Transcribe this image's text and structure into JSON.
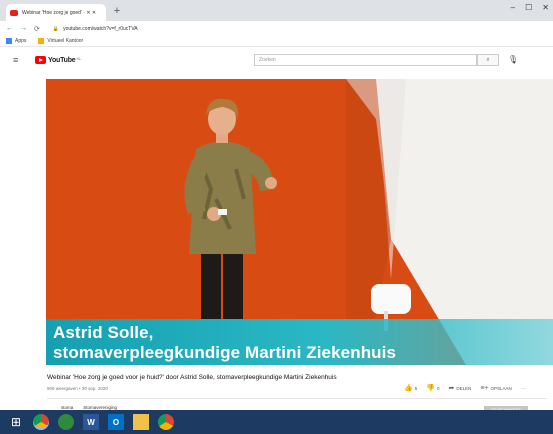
{
  "browser": {
    "tab_title": "Webinar 'Hoe zorg je goed' · ✕ ✕",
    "new_tab_symbol": "+",
    "url": "youtube.com/watch?v=f_r0ucTVA",
    "bookmarks": [
      {
        "label": "Apps",
        "icon": "apps-grid-icon"
      },
      {
        "label": "Virtueel Kantoor",
        "icon": "bookmark-icon"
      }
    ],
    "window_controls": [
      "–",
      "☐",
      "✕"
    ]
  },
  "youtube": {
    "logo_text": "YouTube",
    "logo_region": "NL",
    "search_placeholder": "Zoeken",
    "search_icon": "search-icon",
    "mic_icon": "mic-icon"
  },
  "video": {
    "lower_third_line1": "Astrid Solle,",
    "lower_third_line2": "stomaverpleegkundige Martini Ziekenhuis",
    "colors": {
      "wall_orange": "#d84c14",
      "teal": "#1aa6b6"
    }
  },
  "below_video": {
    "title": "Webinar 'Hoe zorg je goed voor je huid?' door Astrid Solle, stomaverpleegkundige Martini Ziekenhuis",
    "meta": "909 weergaven • 30 sep. 2020",
    "actions": [
      {
        "icon": "thumbs-up-icon",
        "label": "5"
      },
      {
        "icon": "thumbs-down-icon",
        "label": "0"
      },
      {
        "icon": "share-icon",
        "label": "DELEN"
      },
      {
        "icon": "save-icon",
        "label": "OPSLAAN"
      },
      {
        "icon": "more-icon",
        "label": "···"
      }
    ],
    "channel_items": [
      "stoma",
      "Stomavereniging"
    ],
    "subscribe_label": "GEABONNEERD"
  },
  "taskbar": {
    "items": [
      {
        "name": "start-button",
        "glyph": "⊞"
      },
      {
        "name": "chrome-taskbar-icon",
        "glyph": ""
      },
      {
        "name": "app-green-taskbar-icon",
        "glyph": ""
      },
      {
        "name": "word-taskbar-icon",
        "glyph": "W"
      },
      {
        "name": "outlook-taskbar-icon",
        "glyph": "O"
      },
      {
        "name": "files-taskbar-icon",
        "glyph": ""
      },
      {
        "name": "chrome2-taskbar-icon",
        "glyph": ""
      }
    ]
  }
}
